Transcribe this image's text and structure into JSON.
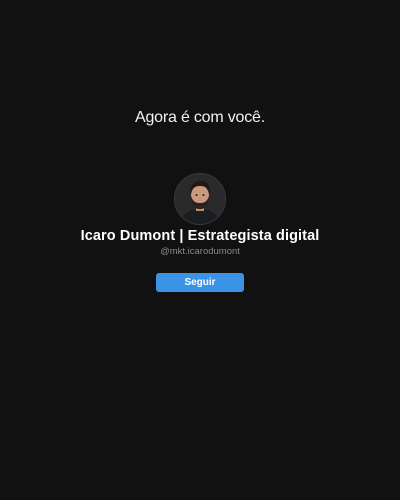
{
  "headline": "Agora é com você.",
  "profile": {
    "name": "Icaro Dumont | Estrategista digital",
    "handle": "@mkt.icarodumont",
    "avatar_icon": "profile-photo"
  },
  "actions": {
    "follow_label": "Seguir"
  },
  "colors": {
    "background": "#111111",
    "button": "#3b93e6",
    "text_primary": "#ffffff",
    "text_secondary": "#8a8a8a"
  }
}
